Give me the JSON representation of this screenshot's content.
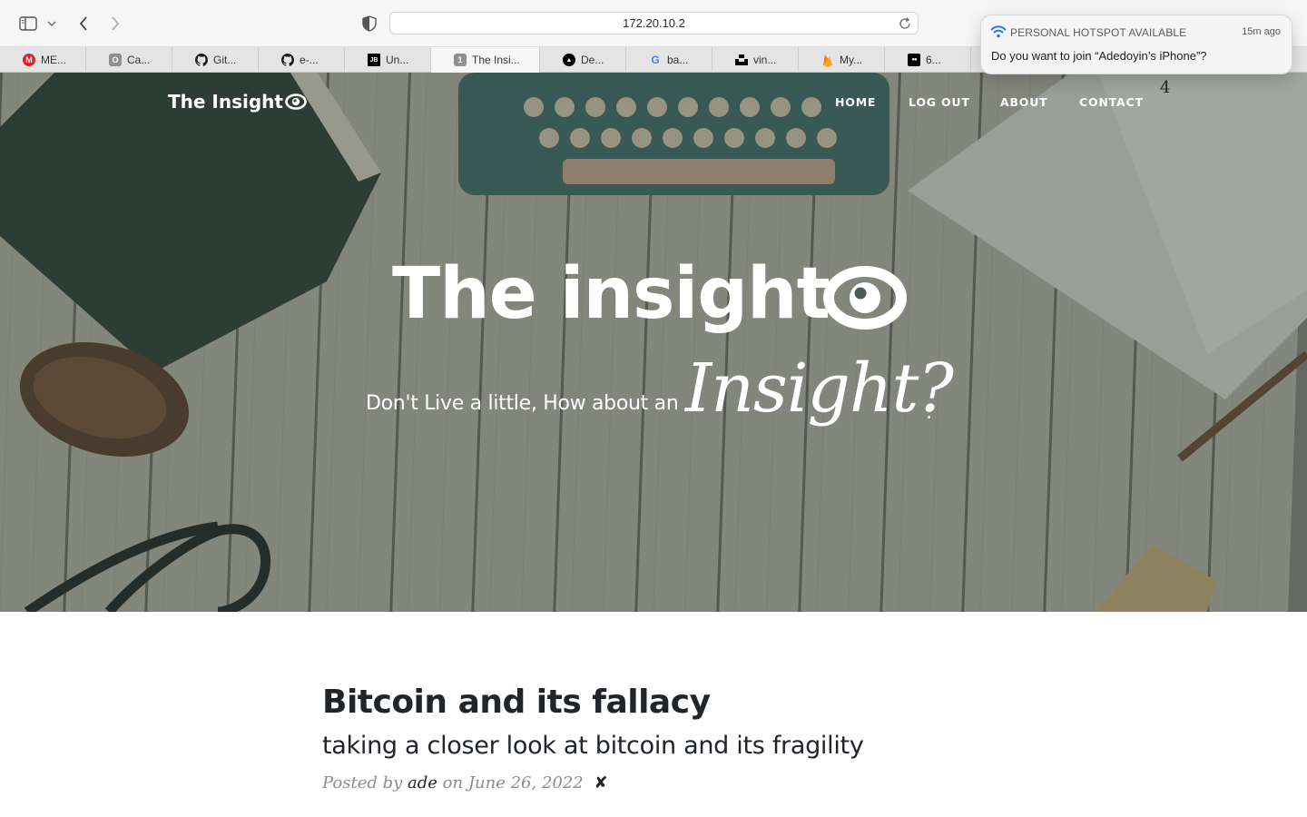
{
  "browser": {
    "address": "172.20.10.2",
    "tabs": [
      {
        "label": "ME...",
        "icon": "mega-icon",
        "color": "#e0232a",
        "glyph": "M"
      },
      {
        "label": "Ca...",
        "icon": "calendar-icon",
        "color": "#8e8e93",
        "glyph": "O"
      },
      {
        "label": "Git...",
        "icon": "github-icon",
        "color": "#1b1f23",
        "glyph": ""
      },
      {
        "label": "e-...",
        "icon": "github-icon",
        "color": "#1b1f23",
        "glyph": ""
      },
      {
        "label": "Un...",
        "icon": "jetbrains-icon",
        "color": "#000000",
        "glyph": "JB"
      },
      {
        "label": "The Insi...",
        "icon": "numbered-tab-icon",
        "color": "#8e8e93",
        "glyph": "1"
      },
      {
        "label": "De...",
        "icon": "triangle-icon",
        "color": "#000000",
        "glyph": "▲"
      },
      {
        "label": "ba...",
        "icon": "google-icon",
        "color": "#4285f4",
        "glyph": "G"
      },
      {
        "label": "vin...",
        "icon": "unsplash-icon",
        "color": "#000000",
        "glyph": "▟"
      },
      {
        "label": "My...",
        "icon": "firebase-icon",
        "color": "#f5a623",
        "glyph": "🔥"
      },
      {
        "label": "6...",
        "icon": "medium-icon",
        "color": "#000000",
        "glyph": "●●"
      }
    ]
  },
  "notification": {
    "title": "PERSONAL HOTSPOT AVAILABLE",
    "time": "15m ago",
    "body": "Do you want to join “Adedoyin’s iPhone”?"
  },
  "site": {
    "brand": "The Insight",
    "nav": [
      "HOME",
      "LOG OUT",
      "ABOUT",
      "CONTACT"
    ],
    "stray_text": "4",
    "hero_title": "The insight",
    "hero_sub": "Don't Live a little, How about an",
    "hero_script": "Insight?",
    "hero_dot": "."
  },
  "post": {
    "title": "Bitcoin and its fallacy",
    "subtitle": "taking a closer look at bitcoin and its fragility",
    "posted_by": "Posted by",
    "author": "ade",
    "date_prefix": "on",
    "date": "June 26, 2022",
    "delete_mark": "✘"
  }
}
